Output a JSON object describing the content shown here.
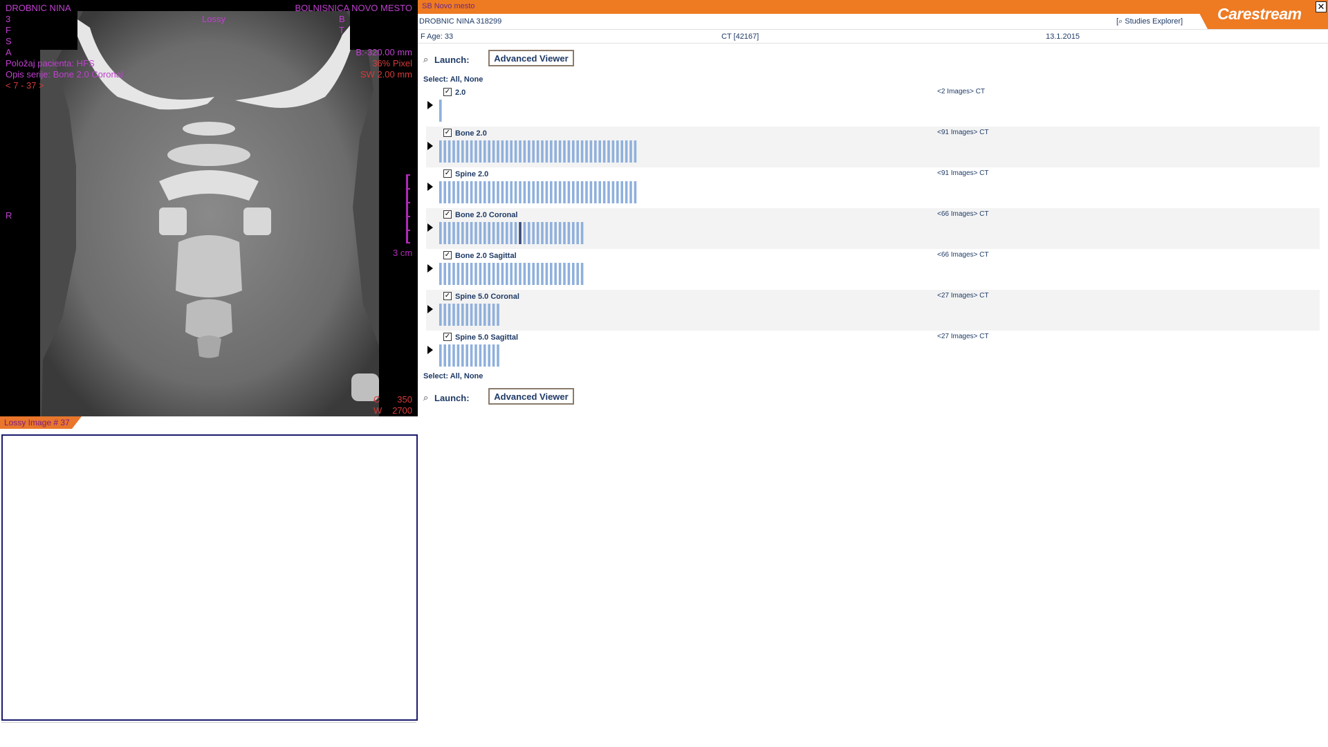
{
  "viewer": {
    "top_left": [
      "DROBNIC NINA",
      "3",
      "F",
      "S",
      "A"
    ],
    "top_center": "Lossy",
    "top_right": "BOLNISNICA NOVO MESTO",
    "top_right_2": "B",
    "top_right_3": "T",
    "slice_info": "B:-320.00 mm",
    "pixel_info": "36% Pixel",
    "sw_info": "SW 2.00 mm",
    "position_label": "Položaj pacienta: HFS",
    "series_desc": "Opis serije: Bone 2.0 Coronal",
    "range": "< 7 - 37 >",
    "orientation_left": "R",
    "scale_label": "3 cm",
    "wl_c_label": "C",
    "wl_c_value": "350",
    "wl_w_label": "W",
    "wl_w_value": "2700",
    "lossy_tab": "Lossy Image # 37"
  },
  "header": {
    "institution": "SB Novo mesto",
    "patient_name_id": "DROBNIC NINA  318299",
    "studies_explorer": "[⌕ Studies Explorer]",
    "logo": "Carestream",
    "sex_age": "F  Age: 33",
    "modality_study": "CT [42167]",
    "study_date": "13.1.2015",
    "close": "✕"
  },
  "launch": {
    "label": "Launch:",
    "button": "Advanced Viewer"
  },
  "select_line": "Select: All, None",
  "series": [
    {
      "name": "2.0",
      "count": "<2 Images> CT",
      "bars": 1
    },
    {
      "name": "Bone 2.0",
      "count": "<91 Images> CT",
      "bars": 45
    },
    {
      "name": "Spine 2.0",
      "count": "<91 Images> CT",
      "bars": 45
    },
    {
      "name": "Bone 2.0 Coronal",
      "count": "<66 Images> CT",
      "bars": 33,
      "highlight": 18
    },
    {
      "name": "Bone 2.0 Sagittal",
      "count": "<66 Images> CT",
      "bars": 33
    },
    {
      "name": "Spine 5.0 Coronal",
      "count": "<27 Images> CT",
      "bars": 14
    },
    {
      "name": "Spine 5.0 Sagittal",
      "count": "<27 Images> CT",
      "bars": 14
    }
  ],
  "colors": {
    "accent": "#ee7a22",
    "overlay_text": "#c040d0",
    "strip_bar": "#8fb0dc",
    "label_text": "#1e3a66"
  }
}
